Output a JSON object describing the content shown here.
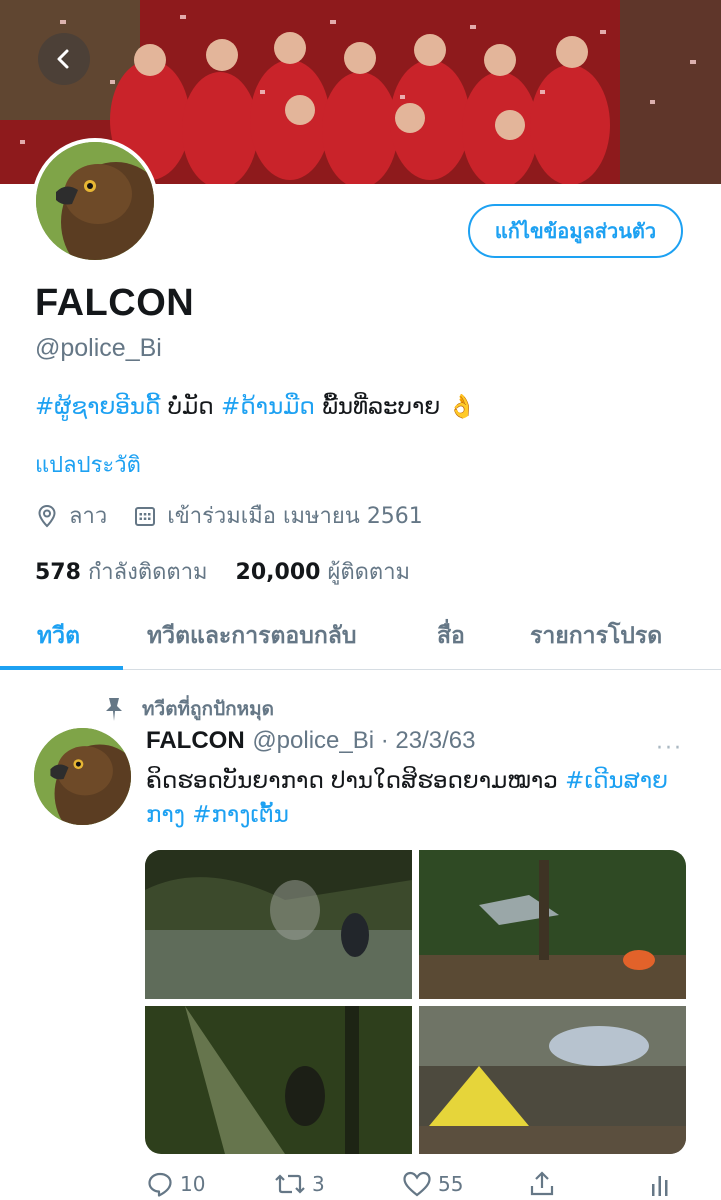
{
  "header": {
    "back_label": "‹",
    "edit_profile_label": "แก้ไขข้อมูลส่วนตัว"
  },
  "profile": {
    "display_name": "FALCON",
    "handle": "@police_Bi",
    "bio": {
      "tag1": "#ຜູ້ຊາຍອີນດີ້",
      "text1": " ບໍ່ມັດ ",
      "tag2": "#ດ້ານມືດ",
      "text2": " ພື້ນທີ່ລະບາຍ 👌"
    },
    "translate_label": "แปลประวัติ",
    "location": "ลาว",
    "joined": "เข้าร่วมเมือ เมษายน 2561",
    "following_count": "578",
    "following_label": "กำลังติดตาม",
    "followers_count": "20,000",
    "followers_label": "ผู้ติดตาม"
  },
  "tabs": [
    {
      "label": "ทวีต"
    },
    {
      "label": "ทวีตและการตอบกลับ"
    },
    {
      "label": "สื่อ"
    },
    {
      "label": "รายการโปรด"
    }
  ],
  "tweet": {
    "pinned_label": "ทวีตที่ถูกปักหมุด",
    "name": "FALCON",
    "handle_date": "@police_Bi · 23/3/63",
    "more_label": "···",
    "text_plain": "ຄິດຮອດບັນຍາກາດ ປານໃດສິຮອດຍາມໝາວ ",
    "tag1": "#ເດີນສາຍ",
    "text_mid": "",
    "tag2": "ກາງ",
    "tag3": " #ກາງເຕັ້ນ",
    "replies": "10",
    "retweets": "3",
    "likes": "55"
  },
  "icons": {
    "back": "chevron-left-icon",
    "location": "location-pin-icon",
    "calendar": "calendar-icon",
    "pin": "pin-icon",
    "reply": "reply-icon",
    "retweet": "retweet-icon",
    "like": "heart-icon",
    "share": "share-icon",
    "analytics": "analytics-icon"
  },
  "colors": {
    "accent": "#1da1f2",
    "secondary_text": "#657786",
    "primary_text": "#14171a"
  }
}
